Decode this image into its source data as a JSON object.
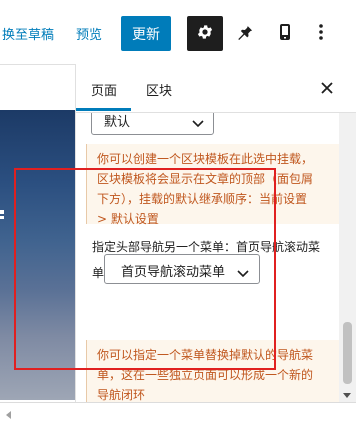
{
  "toolbar": {
    "switch_draft": "换至草稿",
    "preview": "预览",
    "update": "更新",
    "settings_icon": "gear-icon",
    "pin_icon": "pin-icon",
    "device_icon": "mobile-icon",
    "more_icon": "more-vertical-icon"
  },
  "sidebar": {
    "tabs": [
      {
        "label": "页面",
        "active": true
      },
      {
        "label": "区块",
        "active": false
      }
    ],
    "template_select_value": "默认",
    "template_notice": [
      "你可以创建一个区块模板在此选中挂载，",
      "区块模板将会显示在文章的顶部（面包屑",
      "下方），挂载的默认继承顺序：当前设置",
      "> 默认设置"
    ],
    "menu_field_label": "指定头部导航另一个菜单：首页导航滚动菜",
    "menu_prefix": "单",
    "menu_select_value": "首页导航滚动菜单",
    "menu_notice": [
      "你可以指定一个菜单替换掉默认的导航菜",
      "单，这在一些独立页面可以形成一个新的",
      "导航闭环"
    ]
  },
  "colors": {
    "accent": "#007cba",
    "notice_text": "#c0571e",
    "notice_bg": "#fdf6ec",
    "highlight": "#e02020"
  }
}
